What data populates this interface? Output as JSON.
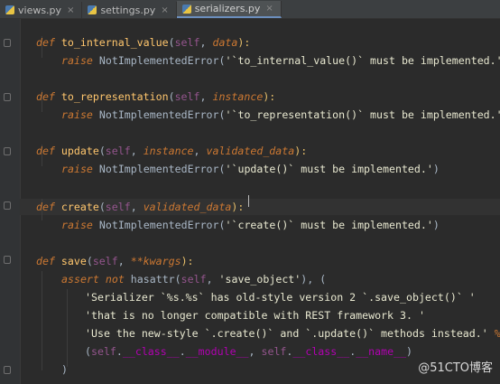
{
  "tabs": [
    {
      "label": "views.py",
      "active": false
    },
    {
      "label": "settings.py",
      "active": false
    },
    {
      "label": "serializers.py",
      "active": true
    }
  ],
  "code": {
    "l1": [
      "def ",
      "to_internal_value",
      "(",
      "self",
      ", ",
      "data",
      "):"
    ],
    "l2": [
      "raise ",
      "NotImplementedError(",
      "'`to_internal_value()` must be implemented.'",
      ")"
    ],
    "l3": [
      "def ",
      "to_representation",
      "(",
      "self",
      ", ",
      "instance",
      "):"
    ],
    "l4": [
      "raise ",
      "NotImplementedError(",
      "'`to_representation()` must be implemented.'",
      ")"
    ],
    "l5": [
      "def ",
      "update",
      "(",
      "self",
      ", ",
      "instance",
      ", ",
      "validated_data",
      "):"
    ],
    "l6": [
      "raise ",
      "NotImplementedError(",
      "'`update()` must be implemented.'",
      ")"
    ],
    "l7": [
      "def ",
      "create",
      "(",
      "self",
      ", ",
      "validated_data",
      "):"
    ],
    "l8": [
      "raise ",
      "NotImplementedError(",
      "'`create()` must be implemented.'",
      ")"
    ],
    "l9": [
      "def ",
      "save",
      "(",
      "self",
      ", ",
      "**kwargs",
      "):"
    ],
    "l10": [
      "assert ",
      "not ",
      "hasattr(",
      "self",
      ", ",
      "'save_object'",
      "), ("
    ],
    "l11": [
      "'Serializer `%s.%s` has old-style version 2 `.save_object()` '"
    ],
    "l12": [
      "'that is no longer compatible with REST framework 3. '"
    ],
    "l13": [
      "'Use the new-style `.create()` and `.update()` methods instead.'",
      " %"
    ],
    "l14": [
      "(",
      "self",
      ".",
      "__class__",
      ".",
      "__module__",
      ", ",
      "self",
      ".",
      "__class__",
      ".",
      "__name__",
      ")"
    ],
    "l15": [
      ")"
    ]
  },
  "watermark": "@51CTO博客"
}
